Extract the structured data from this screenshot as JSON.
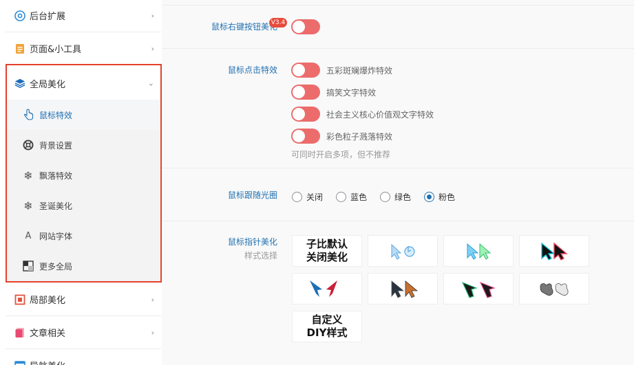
{
  "sidebar": {
    "items": [
      {
        "label": "后台扩展",
        "icon": "gear-icon"
      },
      {
        "label": "页面&小工具",
        "icon": "page-icon"
      },
      {
        "label": "全局美化",
        "icon": "layers-icon"
      },
      {
        "label": "局部美化",
        "icon": "frame-icon"
      },
      {
        "label": "文章相关",
        "icon": "document-icon"
      },
      {
        "label": "导航美化",
        "icon": "nav-icon"
      }
    ],
    "subitems": [
      {
        "label": "鼠标特效",
        "icon": "pointer-hand-icon",
        "active": true
      },
      {
        "label": "背景设置",
        "icon": "lifebuoy-icon"
      },
      {
        "label": "飘落特效",
        "icon": "snowflake-icon"
      },
      {
        "label": "圣诞美化",
        "icon": "snowflake-icon"
      },
      {
        "label": "网站字体",
        "icon": "font-icon"
      },
      {
        "label": "更多全局",
        "icon": "grid-icon"
      }
    ]
  },
  "main": {
    "right_click": {
      "label": "鼠标右键按钮美化",
      "badge": "V3.4"
    },
    "click_effects": {
      "label": "鼠标点击特效",
      "options": [
        "五彩斑斓爆炸特效",
        "搞笑文字特效",
        "社会主义核心价值观文字特效",
        "彩色粒子溅落特效"
      ],
      "note": "可同时开启多项，但不推荐"
    },
    "follow_circle": {
      "label": "鼠标跟随光圈",
      "options": [
        "关闭",
        "蓝色",
        "绿色",
        "粉色"
      ],
      "selected": "粉色"
    },
    "pointer": {
      "label": "鼠标指针美化",
      "sublabel": "样式选择",
      "cards": {
        "close_line1": "子比默认",
        "close_line2": "关闭美化",
        "diy_line1": "自定义",
        "diy_line2": "DIY样式"
      }
    }
  },
  "colors": {
    "accent": "#2271b1",
    "toggle": "#ec6c6c",
    "outline": "#e2402a",
    "badge": "#e74c3c"
  }
}
